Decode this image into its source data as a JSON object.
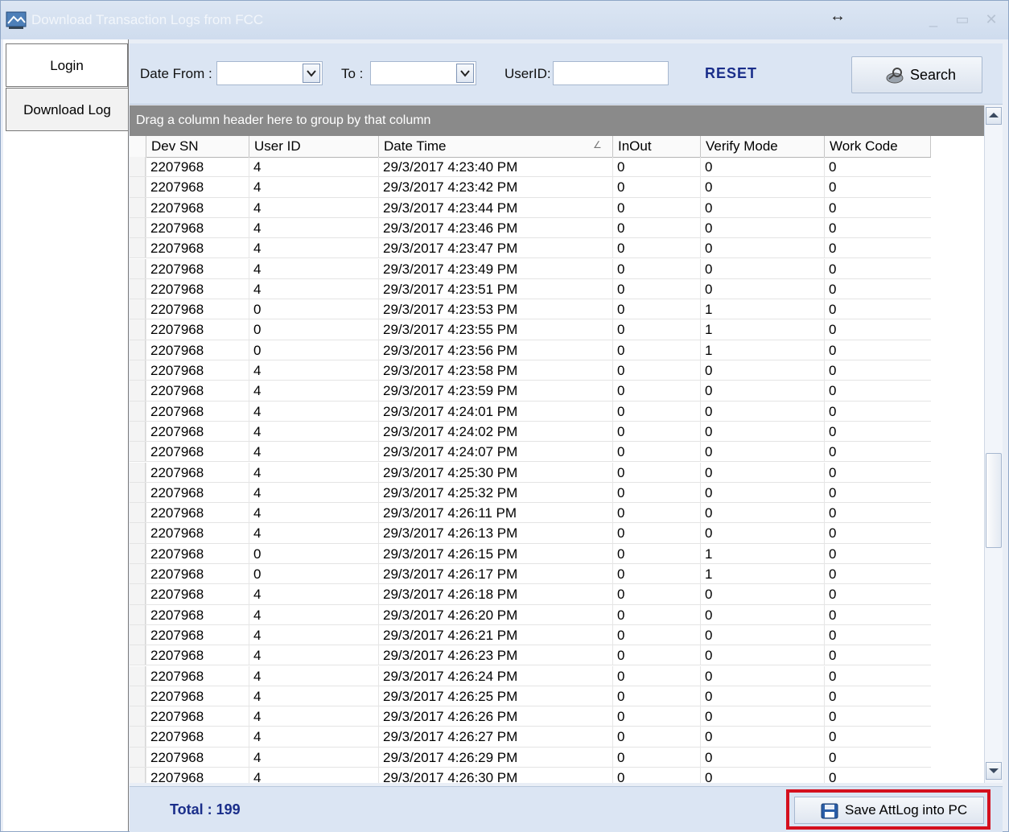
{
  "window": {
    "title": "Download Transaction Logs from FCC",
    "resize_glyph": "↔"
  },
  "icons": {
    "app": "app-icon",
    "minimize": "minimize-icon",
    "maximize": "maximize-icon",
    "close": "close-icon",
    "search": "search-icon",
    "save": "floppy-disk-icon",
    "dropdown": "chevron-down-icon",
    "sort": "sort-indicator-icon"
  },
  "colors": {
    "accent_text": "#1a2e8a",
    "highlight": "#d4101e",
    "group_bar": "#8a8a8a"
  },
  "sidebar": {
    "tabs": [
      {
        "label": "Login"
      },
      {
        "label": "Download Log"
      }
    ]
  },
  "toolbar": {
    "date_from_label": "Date From :",
    "to_label": "To :",
    "userid_label": "UserID:",
    "date_from_value": "",
    "to_value": "",
    "userid_value": "",
    "reset_label": "RESET",
    "search_label": "Search"
  },
  "grid": {
    "group_hint": "Drag a column header here to group by that column",
    "columns": [
      "Dev SN",
      "User ID",
      "Date Time",
      "InOut",
      "Verify Mode",
      "Work Code"
    ],
    "sort_glyph": "∠",
    "rows": [
      [
        "2207968",
        "4",
        "29/3/2017 4:23:40 PM",
        "0",
        "0",
        "0"
      ],
      [
        "2207968",
        "4",
        "29/3/2017 4:23:42 PM",
        "0",
        "0",
        "0"
      ],
      [
        "2207968",
        "4",
        "29/3/2017 4:23:44 PM",
        "0",
        "0",
        "0"
      ],
      [
        "2207968",
        "4",
        "29/3/2017 4:23:46 PM",
        "0",
        "0",
        "0"
      ],
      [
        "2207968",
        "4",
        "29/3/2017 4:23:47 PM",
        "0",
        "0",
        "0"
      ],
      [
        "2207968",
        "4",
        "29/3/2017 4:23:49 PM",
        "0",
        "0",
        "0"
      ],
      [
        "2207968",
        "4",
        "29/3/2017 4:23:51 PM",
        "0",
        "0",
        "0"
      ],
      [
        "2207968",
        "0",
        "29/3/2017 4:23:53 PM",
        "0",
        "1",
        "0"
      ],
      [
        "2207968",
        "0",
        "29/3/2017 4:23:55 PM",
        "0",
        "1",
        "0"
      ],
      [
        "2207968",
        "0",
        "29/3/2017 4:23:56 PM",
        "0",
        "1",
        "0"
      ],
      [
        "2207968",
        "4",
        "29/3/2017 4:23:58 PM",
        "0",
        "0",
        "0"
      ],
      [
        "2207968",
        "4",
        "29/3/2017 4:23:59 PM",
        "0",
        "0",
        "0"
      ],
      [
        "2207968",
        "4",
        "29/3/2017 4:24:01 PM",
        "0",
        "0",
        "0"
      ],
      [
        "2207968",
        "4",
        "29/3/2017 4:24:02 PM",
        "0",
        "0",
        "0"
      ],
      [
        "2207968",
        "4",
        "29/3/2017 4:24:07 PM",
        "0",
        "0",
        "0"
      ],
      [
        "2207968",
        "4",
        "29/3/2017 4:25:30 PM",
        "0",
        "0",
        "0"
      ],
      [
        "2207968",
        "4",
        "29/3/2017 4:25:32 PM",
        "0",
        "0",
        "0"
      ],
      [
        "2207968",
        "4",
        "29/3/2017 4:26:11 PM",
        "0",
        "0",
        "0"
      ],
      [
        "2207968",
        "4",
        "29/3/2017 4:26:13 PM",
        "0",
        "0",
        "0"
      ],
      [
        "2207968",
        "0",
        "29/3/2017 4:26:15 PM",
        "0",
        "1",
        "0"
      ],
      [
        "2207968",
        "0",
        "29/3/2017 4:26:17 PM",
        "0",
        "1",
        "0"
      ],
      [
        "2207968",
        "4",
        "29/3/2017 4:26:18 PM",
        "0",
        "0",
        "0"
      ],
      [
        "2207968",
        "4",
        "29/3/2017 4:26:20 PM",
        "0",
        "0",
        "0"
      ],
      [
        "2207968",
        "4",
        "29/3/2017 4:26:21 PM",
        "0",
        "0",
        "0"
      ],
      [
        "2207968",
        "4",
        "29/3/2017 4:26:23 PM",
        "0",
        "0",
        "0"
      ],
      [
        "2207968",
        "4",
        "29/3/2017 4:26:24 PM",
        "0",
        "0",
        "0"
      ],
      [
        "2207968",
        "4",
        "29/3/2017 4:26:25 PM",
        "0",
        "0",
        "0"
      ],
      [
        "2207968",
        "4",
        "29/3/2017 4:26:26 PM",
        "0",
        "0",
        "0"
      ],
      [
        "2207968",
        "4",
        "29/3/2017 4:26:27 PM",
        "0",
        "0",
        "0"
      ],
      [
        "2207968",
        "4",
        "29/3/2017 4:26:29 PM",
        "0",
        "0",
        "0"
      ],
      [
        "2207968",
        "4",
        "29/3/2017 4:26:30 PM",
        "0",
        "0",
        "0"
      ]
    ]
  },
  "footer": {
    "total_label": "Total : 199",
    "save_label": "Save AttLog into PC"
  }
}
